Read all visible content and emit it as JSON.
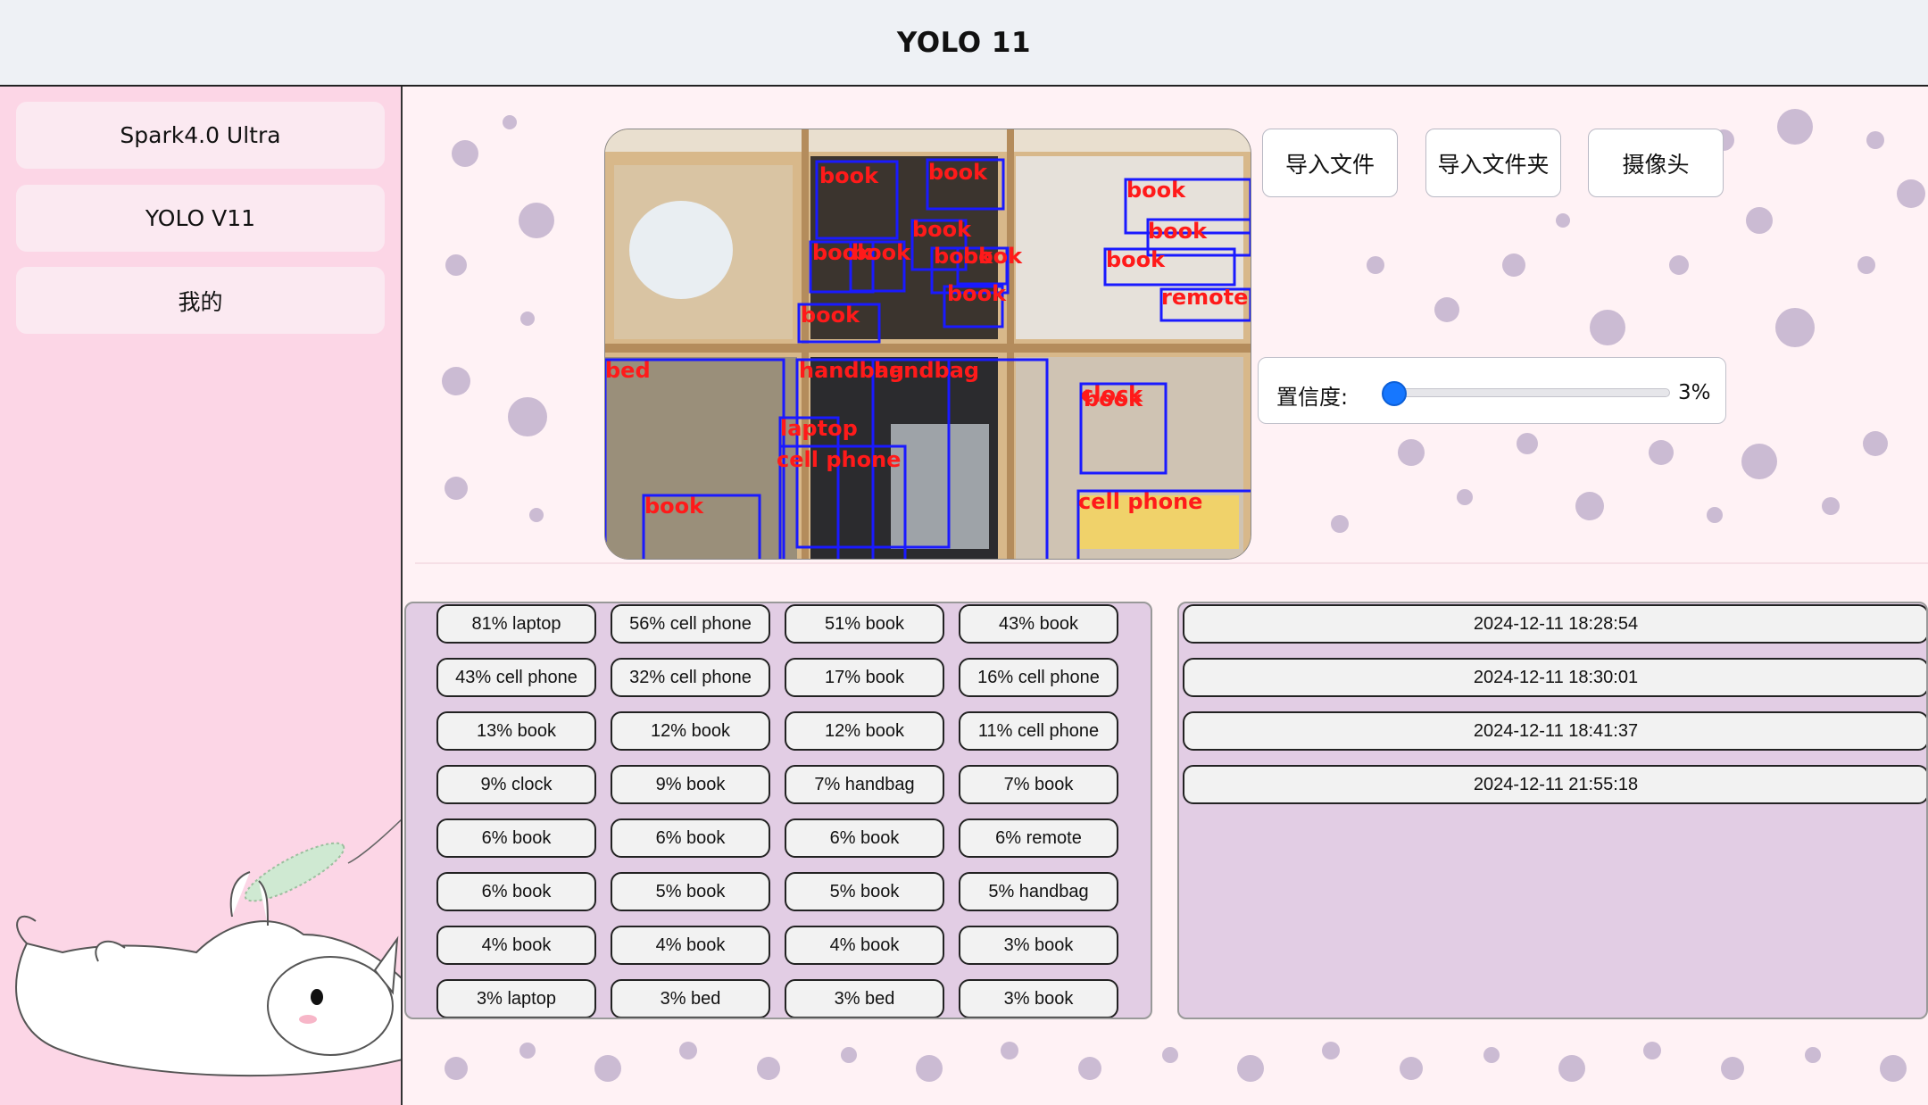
{
  "window": {
    "title": "YOLO 11"
  },
  "sidebar": {
    "items": [
      {
        "label": "Spark4.0 Ultra"
      },
      {
        "label": "YOLO V11"
      },
      {
        "label": "我的"
      }
    ]
  },
  "toolbar": {
    "import_file": "导入文件",
    "import_folder": "导入文件夹",
    "camera": "摄像头"
  },
  "confidence": {
    "label": "置信度:",
    "value_text": "3%",
    "value": 0.03
  },
  "preview": {
    "labels": [
      "book",
      "book",
      "book",
      "book",
      "book",
      "book",
      "book",
      "book",
      "book",
      "book",
      "book",
      "book",
      "remote",
      "bed",
      "handbag",
      "handbag",
      "laptop",
      "cell phone",
      "book",
      "clock",
      "cell phone",
      "book"
    ]
  },
  "detections": [
    "81% laptop",
    "56% cell phone",
    "51% book",
    "43% book",
    "43% cell phone",
    "32% cell phone",
    "17% book",
    "16% cell phone",
    "13% book",
    "12% book",
    "12% book",
    "11% cell phone",
    "9% clock",
    "9% book",
    "7% handbag",
    "7% book",
    "6% book",
    "6% book",
    "6% book",
    "6% remote",
    "6% book",
    "5% book",
    "5% book",
    "5% handbag",
    "4% book",
    "4% book",
    "4% book",
    "3% book",
    "3% laptop",
    "3% bed",
    "3% bed",
    "3% book"
  ],
  "history": [
    "2024-12-11 18:28:54",
    "2024-12-11 18:30:01",
    "2024-12-11 18:41:37",
    "2024-12-11 21:55:18"
  ],
  "colors": {
    "sidebar_bg": "#fcd6e6",
    "main_bg": "#fff2f5",
    "panel_bg": "#e2cde4",
    "box": "#1a1aff",
    "label": "#ff1a1a",
    "slider": "#1677ff"
  }
}
